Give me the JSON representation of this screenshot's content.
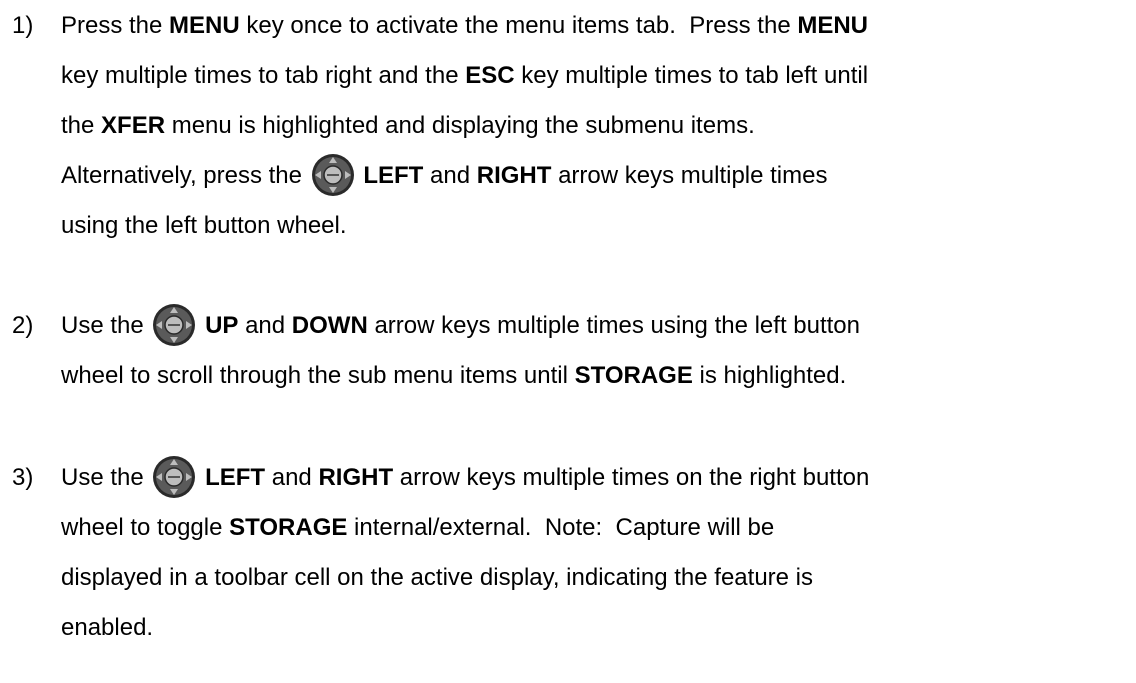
{
  "steps": [
    {
      "number": "1)",
      "lines": [
        [
          {
            "t": "Press the "
          },
          {
            "t": "MENU",
            "b": true
          },
          {
            "t": " key once to activate the menu items tab.  Press the "
          },
          {
            "t": "MENU",
            "b": true
          }
        ],
        [
          {
            "t": "key multiple times to tab right and the "
          },
          {
            "t": "ESC",
            "b": true
          },
          {
            "t": " key multiple times to tab left until"
          }
        ],
        [
          {
            "t": "the "
          },
          {
            "t": "XFER",
            "b": true
          },
          {
            "t": " menu is highlighted and displaying the submenu items."
          }
        ],
        [
          {
            "t": "Alternatively, press the "
          },
          {
            "icon": "dpad-enter-icon"
          },
          {
            "t": " "
          },
          {
            "t": "LEFT",
            "b": true
          },
          {
            "t": " and "
          },
          {
            "t": "RIGHT",
            "b": true
          },
          {
            "t": " arrow keys multiple times"
          }
        ],
        [
          {
            "t": "using the left button wheel."
          }
        ]
      ]
    },
    {
      "number": "2)",
      "lines": [
        [
          {
            "t": "Use the "
          },
          {
            "icon": "dpad-enter-icon"
          },
          {
            "t": " "
          },
          {
            "t": "UP",
            "b": true
          },
          {
            "t": " and "
          },
          {
            "t": "DOWN",
            "b": true
          },
          {
            "t": " arrow keys multiple times using the left button"
          }
        ],
        [
          {
            "t": "wheel to scroll through the sub menu items until "
          },
          {
            "t": "STORAGE",
            "b": true
          },
          {
            "t": " is highlighted."
          }
        ]
      ]
    },
    {
      "number": "3)",
      "lines": [
        [
          {
            "t": "Use the "
          },
          {
            "icon": "dpad-save-icon"
          },
          {
            "t": " "
          },
          {
            "t": "LEFT",
            "b": true
          },
          {
            "t": " and "
          },
          {
            "t": "RIGHT",
            "b": true
          },
          {
            "t": " arrow keys multiple times on the right button"
          }
        ],
        [
          {
            "t": "wheel to toggle "
          },
          {
            "t": "STORAGE",
            "b": true
          },
          {
            "t": " internal/external.  Note:  Capture will be"
          }
        ],
        [
          {
            "t": "displayed in a toolbar cell on the active display, indicating the feature is"
          }
        ],
        [
          {
            "t": "enabled."
          }
        ]
      ]
    }
  ],
  "colors": {
    "text": "#000000",
    "background": "#ffffff",
    "icon_dark": "#2a2a2a",
    "icon_light": "#bdbdbd"
  }
}
